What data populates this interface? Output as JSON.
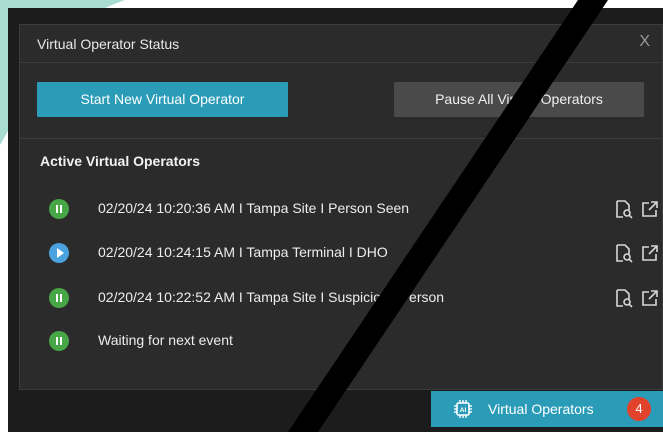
{
  "dialog": {
    "title": "Virtual Operator Status",
    "close_label": "X",
    "start_button": "Start New Virtual Operator",
    "pause_all_button": "Pause All Virtual Operators",
    "section_title": "Active Virtual Operators"
  },
  "operators": [
    {
      "state": "paused",
      "text": "02/20/24 10:20:36 AM  I  Tampa Site  I  Person Seen",
      "has_actions": true
    },
    {
      "state": "playing",
      "text": "02/20/24 10:24:15 AM  I  Tampa Terminal  I  DHO",
      "has_actions": true
    },
    {
      "state": "paused",
      "text": "02/20/24 10:22:52 AM  I  Tampa Site  I  Suspicious Person",
      "has_actions": true
    },
    {
      "state": "paused",
      "text": "Waiting for next event",
      "has_actions": false
    }
  ],
  "taskbar": {
    "label": "Virtual Operators",
    "icon": "ai-chip-icon",
    "badge_count": "4"
  },
  "colors": {
    "accent": "#2a9cb8",
    "paused_status": "#47a646",
    "playing_status": "#4aa3df",
    "badge": "#e1422b",
    "window_bg": "#2b2b2b",
    "backdrop_teal": "#a9ddd2"
  },
  "icons": [
    "pause-icon",
    "play-icon",
    "inspect-document-icon",
    "open-external-icon",
    "ai-chip-icon",
    "close-icon"
  ]
}
